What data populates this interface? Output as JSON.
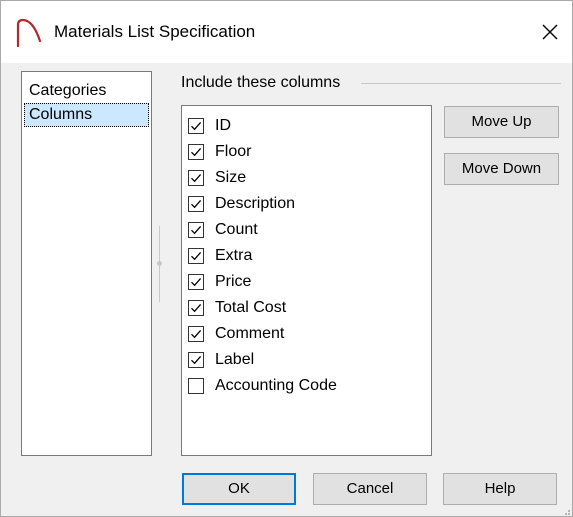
{
  "window": {
    "title": "Materials List Specification",
    "close_glyph": "✕"
  },
  "categories": {
    "items": [
      {
        "label": "Categories",
        "selected": false
      },
      {
        "label": "Columns",
        "selected": true
      }
    ]
  },
  "columns_group": {
    "title": "Include these columns",
    "items": [
      {
        "label": "ID",
        "checked": true
      },
      {
        "label": "Floor",
        "checked": true
      },
      {
        "label": "Size",
        "checked": true
      },
      {
        "label": "Description",
        "checked": true
      },
      {
        "label": "Count",
        "checked": true
      },
      {
        "label": "Extra",
        "checked": true
      },
      {
        "label": "Price",
        "checked": true
      },
      {
        "label": "Total Cost",
        "checked": true
      },
      {
        "label": "Comment",
        "checked": true
      },
      {
        "label": "Label",
        "checked": true
      },
      {
        "label": "Accounting Code",
        "checked": false
      }
    ]
  },
  "buttons": {
    "move_up": "Move Up",
    "move_down": "Move Down",
    "ok": "OK",
    "cancel": "Cancel",
    "help": "Help"
  },
  "colors": {
    "app_icon": "#b0292c",
    "selection": "#cce8ff",
    "default_button_border": "#0078d7",
    "dialog_background": "#f0f0f0"
  },
  "icons": {
    "app": "arch-icon",
    "close": "close-icon",
    "check": "checkmark-icon",
    "resize": "resize-grip-icon"
  }
}
